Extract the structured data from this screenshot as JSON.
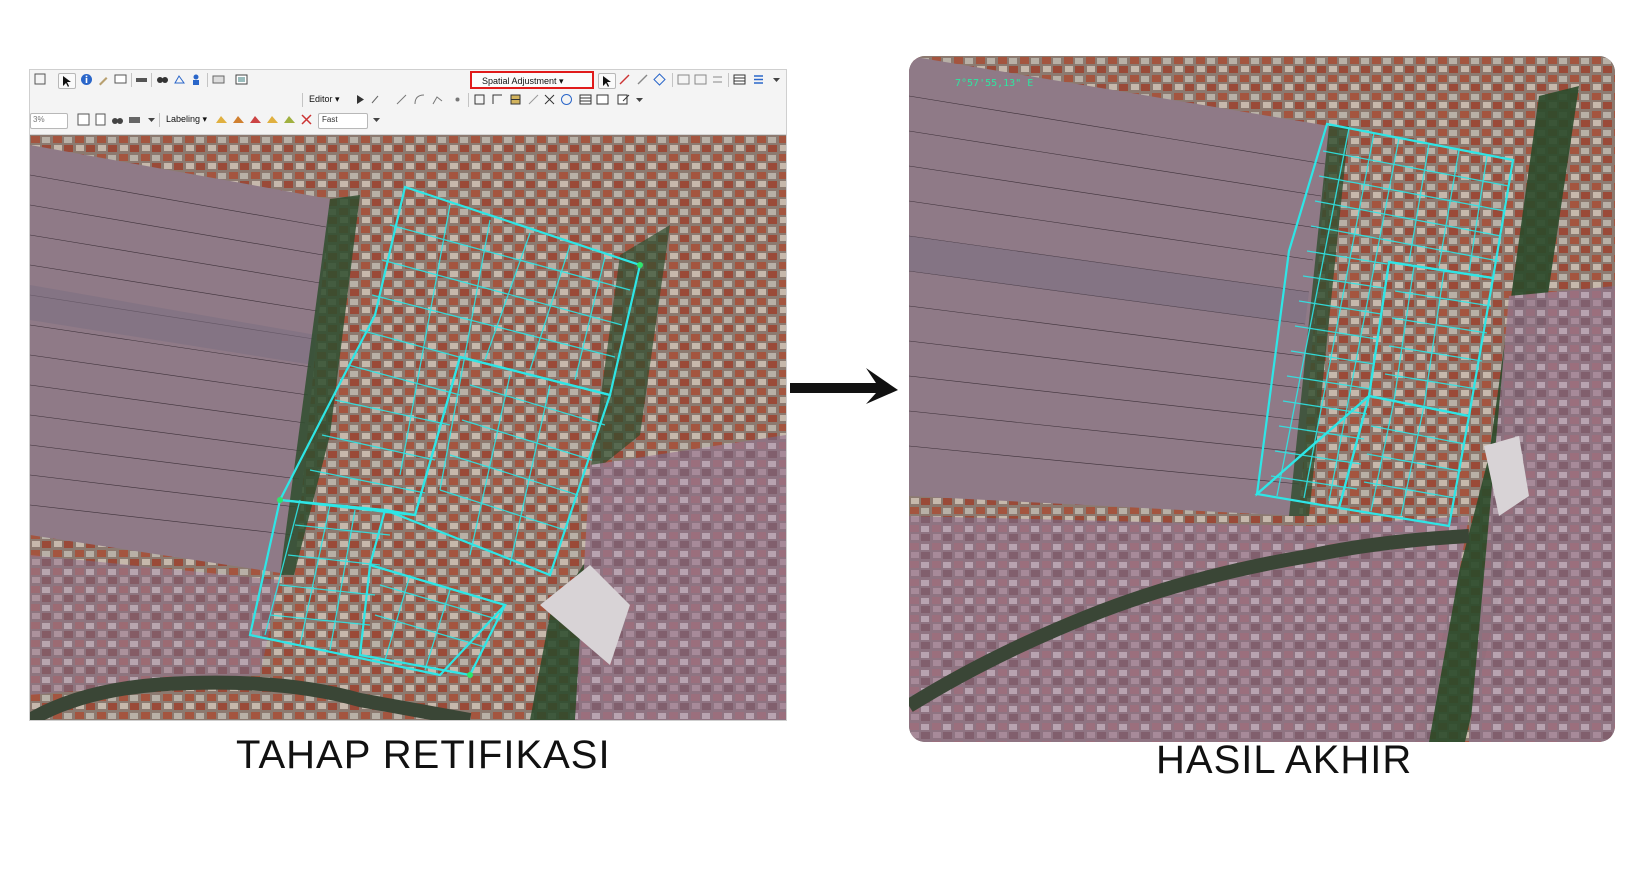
{
  "left_panel": {
    "toolbar": {
      "spatial_adjustment_label": "Spatial Adjustment ▾",
      "editor_label": "Editor ▾",
      "labeling_label": "Labeling ▾",
      "quality_value": "Fast",
      "scale_value": "3%"
    },
    "map_layer": "satellite-imagery-with-parcels"
  },
  "right_panel": {
    "coordinate_readout": "7°57'55,13\" E"
  },
  "captions": {
    "left": "TAHAP RETIFIKASI",
    "right": "HASIL AKHIR"
  },
  "colors": {
    "parcel_outline": "#2ee6e6",
    "highlight_box": "#e01a1a",
    "arrow": "#111111"
  }
}
